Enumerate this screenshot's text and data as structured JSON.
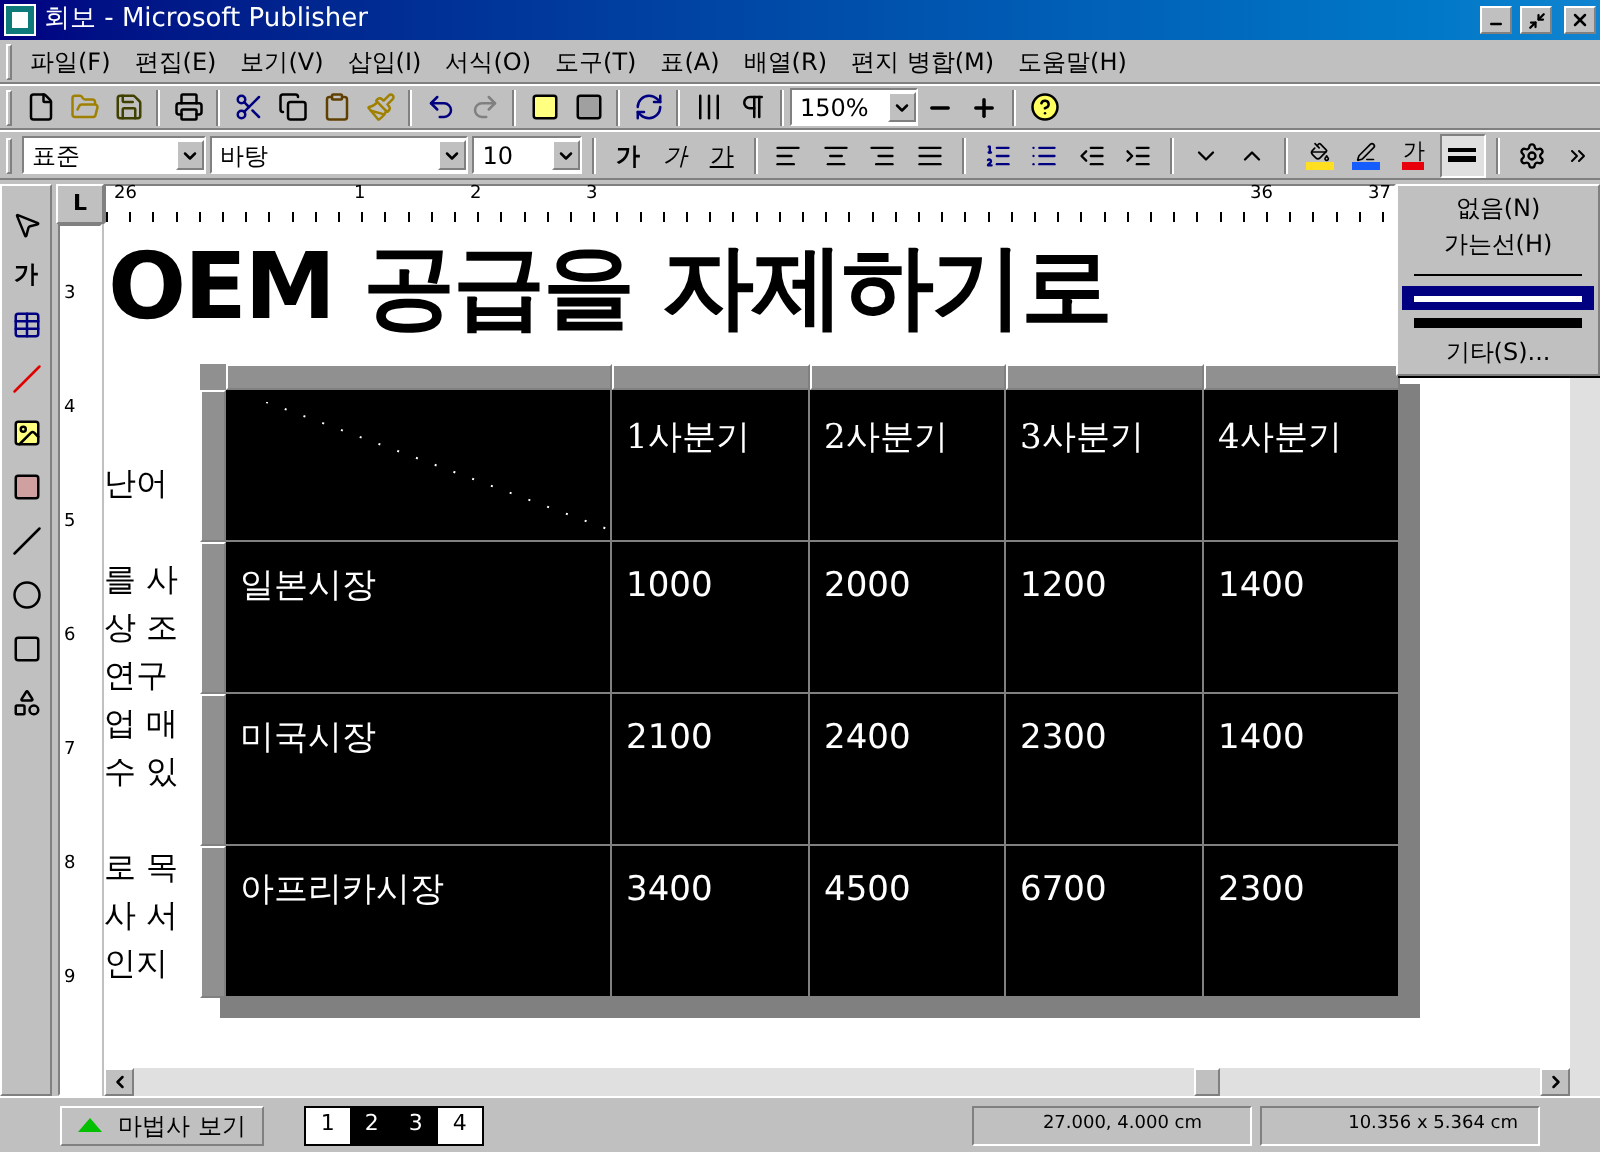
{
  "window": {
    "title": "회보 - Microsoft Publisher"
  },
  "menu": [
    "파일(F)",
    "편집(E)",
    "보기(V)",
    "삽입(I)",
    "서식(O)",
    "도구(T)",
    "표(A)",
    "배열(R)",
    "편지 병합(M)",
    "도움말(H)"
  ],
  "zoom": {
    "value": "150%"
  },
  "format_bar": {
    "style": "표준",
    "font": "바탕",
    "size": "10",
    "bold": "가",
    "italic": "가",
    "underline": "가",
    "font_color": "가"
  },
  "tools": {
    "text_tool": "가"
  },
  "ruler": {
    "corner": "L",
    "h_labels": [
      "26",
      "1",
      "2",
      "3",
      "36",
      "37"
    ],
    "v_labels": [
      "3",
      "4",
      "5",
      "6",
      "7",
      "8",
      "9"
    ]
  },
  "headline": "OEM 공급을 자제하기로",
  "body_fragments": [
    "난어",
    "를 사",
    "상 조",
    "연구",
    "업 매",
    "수 있",
    "로 목",
    "사 서",
    "인지"
  ],
  "table": {
    "columns": [
      "",
      "1사분기",
      "2사분기",
      "3사분기",
      "4사분기"
    ],
    "rows": [
      [
        "일본시장",
        "1000",
        "2000",
        "1200",
        "1400"
      ],
      [
        "미국시장",
        "2100",
        "2400",
        "2300",
        "1400"
      ],
      [
        "아프리카시장",
        "3400",
        "4500",
        "6700",
        "2300"
      ]
    ]
  },
  "line_menu": [
    {
      "kind": "text",
      "label": "없음(N)",
      "selected": false
    },
    {
      "kind": "text",
      "label": "가는선(H)",
      "selected": false
    },
    {
      "kind": "thin_line",
      "selected": false
    },
    {
      "kind": "medium_line",
      "selected": true
    },
    {
      "kind": "thick_line",
      "selected": false
    },
    {
      "kind": "text",
      "label": "기타(S)...",
      "selected": false
    }
  ],
  "status_bar": {
    "wizard": "마법사 보기",
    "pages": [
      {
        "label": "1",
        "selected": false
      },
      {
        "label": "2",
        "selected": true
      },
      {
        "label": "3",
        "selected": true
      },
      {
        "label": "4",
        "selected": false
      }
    ],
    "position": "27.000, 4.000 cm",
    "size": "10.356 x  5.364 cm"
  }
}
